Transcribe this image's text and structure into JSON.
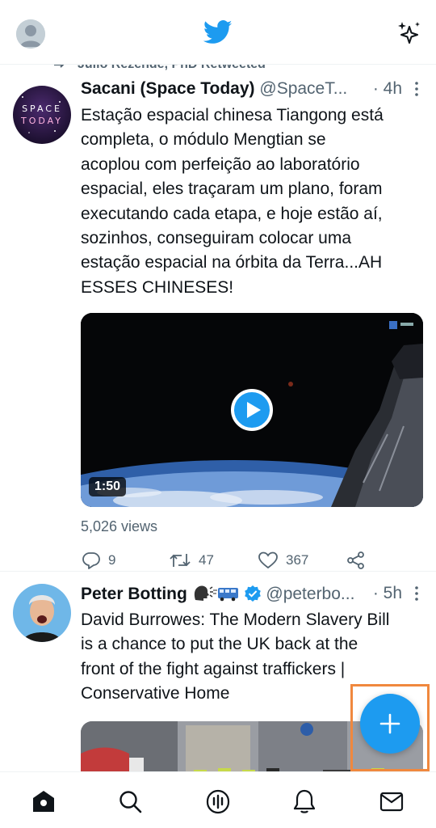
{
  "header": {
    "avatar_icon": "profile-icon",
    "logo_icon": "twitter-bird-icon",
    "sparkle_icon": "sparkle-icon"
  },
  "retweet": {
    "label": "Julio Rezende, PhD Retweeted"
  },
  "tweets": [
    {
      "name": "Sacani (Space Today)",
      "handle": "@SpaceT...",
      "time": "· 4h",
      "avatar_text_1": "SPACE",
      "avatar_text_2": "TODAY",
      "text_lines": [
        "Estação espacial chinesa Tiangong está",
        "completa, o módulo Mengtian se",
        "acoplou com perfeição ao laboratório",
        "espacial, eles traçaram um plano, foram",
        "executando cada etapa, e hoje estão aí,",
        "sozinhos, conseguiram colocar uma",
        "estação espacial na órbita da Terra...AH",
        "ESSES CHINESES!"
      ],
      "video_duration": "1:50",
      "views": "5,026 views",
      "replies": "9",
      "retweets": "47",
      "likes": "367"
    },
    {
      "name": "Peter Botting",
      "handle": "@peterbo...",
      "time": "· 5h",
      "text_lines": [
        "David Burrowes: The Modern Slavery Bill",
        "is a chance to put the UK back at the",
        "front of the fight against traffickers |",
        "Conservative Home"
      ]
    }
  ],
  "nav": {
    "items": [
      "home-icon",
      "search-icon",
      "spaces-icon",
      "notifications-icon",
      "messages-icon"
    ]
  },
  "colors": {
    "accent": "#1d9bf0",
    "text": "#0f1419",
    "secondary": "#536471",
    "highlight": "#f0883e"
  }
}
